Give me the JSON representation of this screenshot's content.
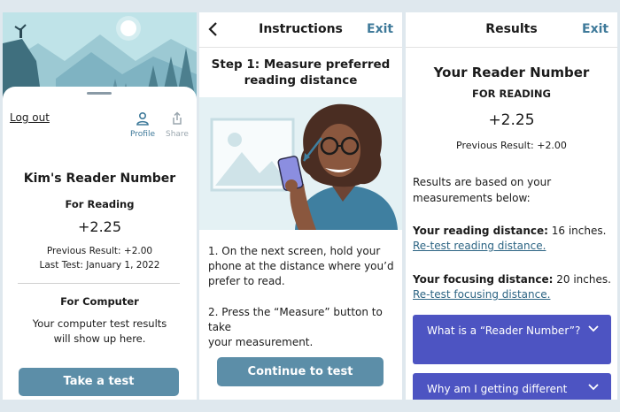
{
  "home": {
    "logout": "Log out",
    "profile_label": "Profile",
    "share_label": "Share",
    "title": "Kim's Reader Number",
    "reading_heading": "For Reading",
    "reading_value": "+2.25",
    "previous_result": "Previous Result: +2.00",
    "last_test": "Last Test: January 1, 2022",
    "computer_heading": "For Computer",
    "computer_line1": "Your computer test results",
    "computer_line2": "will show up here.",
    "button": "Take a test"
  },
  "instructions": {
    "title": "Instructions",
    "exit": "Exit",
    "step_line1": "Step 1: Measure preferred",
    "step_line2": "reading distance",
    "item1_lines": [
      "1. On the next screen, hold your",
      "phone at the distance where you’d",
      "prefer to read."
    ],
    "item2_lines": [
      "2. Press the “Measure” button to take",
      "your measurement."
    ],
    "button": "Continue to test"
  },
  "results": {
    "title": "Results",
    "exit": "Exit",
    "heading": "Your Reader Number",
    "for_reading": "FOR READING",
    "value": "+2.25",
    "previous": "Previous Result: +2.00",
    "based_line1": "Results are based on your",
    "based_line2": "measurements below:",
    "reading_label": "Your reading distance:",
    "reading_value": " 16 inches.",
    "retest_reading": "Re-test reading distance.",
    "focusing_label": "Your focusing distance:",
    "focusing_value": " 20 inches.",
    "retest_focusing": "Re-test focusing distance.",
    "faq1": "What is a “Reader Number”?",
    "faq2": "Why am I getting different"
  },
  "colors": {
    "accent": "#3f7a9a",
    "button": "#5c8ea8",
    "accordion": "#4d54c2",
    "link": "#2c6483"
  }
}
